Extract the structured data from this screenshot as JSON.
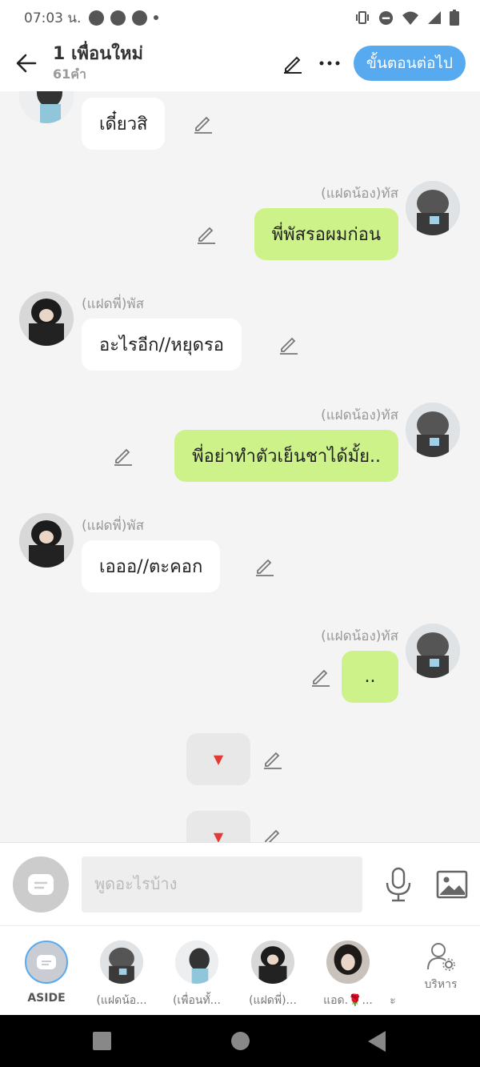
{
  "status_bar": {
    "time": "07:03 น."
  },
  "header": {
    "title": "1 เพื่อนใหม่",
    "subtitle": "61คำ",
    "next_button": "ขั้นตอนต่อไป"
  },
  "messages": [
    {
      "side": "left",
      "name": "",
      "text": "เดี๋ยวสิ",
      "avatar": "character-2-avatar"
    },
    {
      "side": "right",
      "name": "(แฝดน้อง)ทัส",
      "text": "พี่พัสรอผมก่อน",
      "avatar": "character-1-avatar"
    },
    {
      "side": "left",
      "name": "(แฝดพี่)พัส",
      "text": "อะไรอีก//หยุดรอ",
      "avatar": "character-3-avatar"
    },
    {
      "side": "right",
      "name": "(แฝดน้อง)ทัส",
      "text": "พี่อย่าทำตัวเย็นชาได้มั้ย..",
      "avatar": "character-1-avatar"
    },
    {
      "side": "left",
      "name": "(แฝดพี่)พัส",
      "text": "เอออ//ตะคอก",
      "avatar": "character-3-avatar"
    },
    {
      "side": "right",
      "name": "(แฝดน้อง)ทัส",
      "text": "..",
      "avatar": "character-1-avatar"
    },
    {
      "side": "center",
      "text": "▼"
    },
    {
      "side": "center",
      "text": "▼"
    }
  ],
  "input": {
    "placeholder": "พูดอะไรบ้าง"
  },
  "tray": {
    "items": [
      {
        "label": "ASIDE"
      },
      {
        "label": "(แฝดน้อ..."
      },
      {
        "label": "(เพื่อนทั้..."
      },
      {
        "label": "(แฝดพี่)..."
      },
      {
        "label": "แอด.🌹..."
      },
      {
        "label": "ะ"
      }
    ],
    "manage_label": "บริหาร"
  },
  "colors": {
    "accent": "#58aaf0",
    "bubble_green": "#cdf28a",
    "bubble_white": "#ffffff",
    "marker_red": "#e53935"
  }
}
